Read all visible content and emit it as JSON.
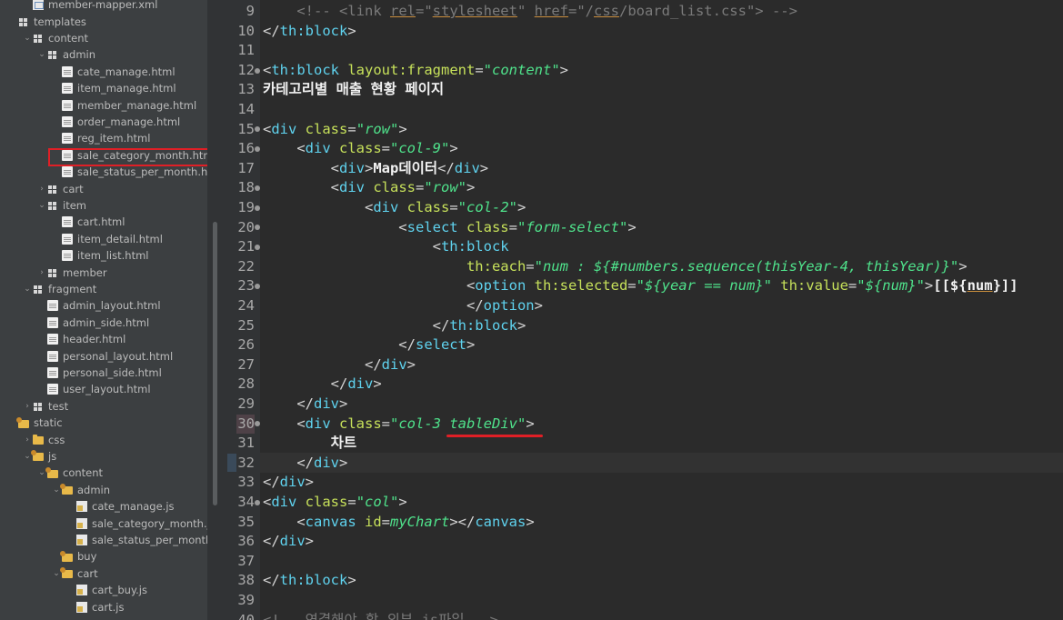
{
  "project_tree": {
    "items": [
      {
        "label": "member-mapper.xml",
        "icon": "xml-file-icon",
        "kind": "xml",
        "indent": 1,
        "arrow": ""
      },
      {
        "label": "templates",
        "icon": "package-icon",
        "kind": "pkg",
        "indent": 0,
        "arrow": ""
      },
      {
        "label": "content",
        "icon": "package-icon",
        "kind": "pkg",
        "indent": 1,
        "arrow": "⌄"
      },
      {
        "label": "admin",
        "icon": "package-icon",
        "kind": "pkg",
        "indent": 2,
        "arrow": "⌄"
      },
      {
        "label": "cate_manage.html",
        "icon": "html-file-icon",
        "kind": "file",
        "indent": 3,
        "arrow": ""
      },
      {
        "label": "item_manage.html",
        "icon": "html-file-icon",
        "kind": "file",
        "indent": 3,
        "arrow": ""
      },
      {
        "label": "member_manage.html",
        "icon": "html-file-icon",
        "kind": "file",
        "indent": 3,
        "arrow": ""
      },
      {
        "label": "order_manage.html",
        "icon": "html-file-icon",
        "kind": "file",
        "indent": 3,
        "arrow": ""
      },
      {
        "label": "reg_item.html",
        "icon": "html-file-icon",
        "kind": "file",
        "indent": 3,
        "arrow": ""
      },
      {
        "label": "sale_category_month.html",
        "icon": "html-file-icon",
        "kind": "file",
        "indent": 3,
        "arrow": ""
      },
      {
        "label": "sale_status_per_month.html",
        "icon": "html-file-icon",
        "kind": "file",
        "indent": 3,
        "arrow": ""
      },
      {
        "label": "cart",
        "icon": "package-icon",
        "kind": "pkg",
        "indent": 2,
        "arrow": "›"
      },
      {
        "label": "item",
        "icon": "package-icon",
        "kind": "pkg",
        "indent": 2,
        "arrow": "⌄"
      },
      {
        "label": "cart.html",
        "icon": "html-file-icon",
        "kind": "file",
        "indent": 3,
        "arrow": ""
      },
      {
        "label": "item_detail.html",
        "icon": "html-file-icon",
        "kind": "file",
        "indent": 3,
        "arrow": ""
      },
      {
        "label": "item_list.html",
        "icon": "html-file-icon",
        "kind": "file",
        "indent": 3,
        "arrow": ""
      },
      {
        "label": "member",
        "icon": "package-icon",
        "kind": "pkg",
        "indent": 2,
        "arrow": "›"
      },
      {
        "label": "fragment",
        "icon": "package-icon",
        "kind": "pkg",
        "indent": 1,
        "arrow": "⌄"
      },
      {
        "label": "admin_layout.html",
        "icon": "html-file-icon",
        "kind": "file",
        "indent": 2,
        "arrow": ""
      },
      {
        "label": "admin_side.html",
        "icon": "html-file-icon",
        "kind": "file",
        "indent": 2,
        "arrow": ""
      },
      {
        "label": "header.html",
        "icon": "html-file-icon",
        "kind": "file",
        "indent": 2,
        "arrow": ""
      },
      {
        "label": "personal_layout.html",
        "icon": "html-file-icon",
        "kind": "file",
        "indent": 2,
        "arrow": ""
      },
      {
        "label": "personal_side.html",
        "icon": "html-file-icon",
        "kind": "file",
        "indent": 2,
        "arrow": ""
      },
      {
        "label": "user_layout.html",
        "icon": "html-file-icon",
        "kind": "file",
        "indent": 2,
        "arrow": ""
      },
      {
        "label": "test",
        "icon": "package-icon",
        "kind": "pkg",
        "indent": 1,
        "arrow": "›"
      },
      {
        "label": "static",
        "icon": "folder-icon",
        "kind": "tfolder",
        "indent": 0,
        "arrow": ""
      },
      {
        "label": "css",
        "icon": "folder-icon",
        "kind": "folder",
        "indent": 1,
        "arrow": "›"
      },
      {
        "label": "js",
        "icon": "folder-icon",
        "kind": "tfolder",
        "indent": 1,
        "arrow": "⌄"
      },
      {
        "label": "content",
        "icon": "folder-icon",
        "kind": "tfolder",
        "indent": 2,
        "arrow": "⌄"
      },
      {
        "label": "admin",
        "icon": "folder-icon",
        "kind": "tfolder",
        "indent": 3,
        "arrow": "⌄"
      },
      {
        "label": "cate_manage.js",
        "icon": "js-file-icon",
        "kind": "js",
        "indent": 4,
        "arrow": ""
      },
      {
        "label": "sale_category_month.js",
        "icon": "js-file-icon",
        "kind": "js",
        "indent": 4,
        "arrow": ""
      },
      {
        "label": "sale_status_per_month.js",
        "icon": "js-file-icon",
        "kind": "js",
        "indent": 4,
        "arrow": ""
      },
      {
        "label": "buy",
        "icon": "folder-icon",
        "kind": "tfolder",
        "indent": 3,
        "arrow": ""
      },
      {
        "label": "cart",
        "icon": "folder-icon",
        "kind": "tfolder",
        "indent": 3,
        "arrow": "⌄"
      },
      {
        "label": "cart_buy.js",
        "icon": "js-file-icon",
        "kind": "js",
        "indent": 4,
        "arrow": ""
      },
      {
        "label": "cart.js",
        "icon": "js-file-icon",
        "kind": "js",
        "indent": 4,
        "arrow": ""
      }
    ]
  },
  "editor": {
    "lines": [
      {
        "no": "9",
        "fold": false,
        "tokens": [
          [
            "c",
            "    <!-- <link "
          ],
          [
            "c u",
            "rel"
          ],
          [
            "c",
            "=\""
          ],
          [
            "c u",
            "stylesheet"
          ],
          [
            "c",
            "\" "
          ],
          [
            "c u",
            "href"
          ],
          [
            "c",
            "=\"/"
          ],
          [
            "c u",
            "css"
          ],
          [
            "c",
            "/board_list.css\"> -->"
          ]
        ]
      },
      {
        "no": "10",
        "fold": false,
        "tokens": [
          [
            "p",
            "</"
          ],
          [
            "t",
            "th:block"
          ],
          [
            "p",
            ">"
          ]
        ]
      },
      {
        "no": "11",
        "fold": false,
        "tokens": []
      },
      {
        "no": "12",
        "fold": true,
        "tokens": [
          [
            "p",
            "<"
          ],
          [
            "t",
            "th:block "
          ],
          [
            "a",
            "layout:fragment"
          ],
          [
            "p",
            "="
          ],
          [
            "s",
            "\"content\""
          ],
          [
            "p",
            ">"
          ]
        ]
      },
      {
        "no": "13",
        "fold": false,
        "tokens": [
          [
            "k",
            "카테고리별 매출 현황 페이지"
          ]
        ]
      },
      {
        "no": "14",
        "fold": false,
        "tokens": []
      },
      {
        "no": "15",
        "fold": true,
        "tokens": [
          [
            "p",
            "<"
          ],
          [
            "t",
            "div "
          ],
          [
            "a",
            "class"
          ],
          [
            "p",
            "="
          ],
          [
            "s",
            "\"row\""
          ],
          [
            "p",
            ">"
          ]
        ]
      },
      {
        "no": "16",
        "fold": true,
        "tokens": [
          [
            "p",
            "    <"
          ],
          [
            "t",
            "div "
          ],
          [
            "a",
            "class"
          ],
          [
            "p",
            "="
          ],
          [
            "s",
            "\"col-9\""
          ],
          [
            "p",
            ">"
          ]
        ]
      },
      {
        "no": "17",
        "fold": false,
        "tokens": [
          [
            "p",
            "        <"
          ],
          [
            "t",
            "div"
          ],
          [
            "p",
            ">"
          ],
          [
            "k",
            "Map데이터"
          ],
          [
            "p",
            "</"
          ],
          [
            "t",
            "div"
          ],
          [
            "p",
            ">"
          ]
        ]
      },
      {
        "no": "18",
        "fold": true,
        "tokens": [
          [
            "p",
            "        <"
          ],
          [
            "t",
            "div "
          ],
          [
            "a",
            "class"
          ],
          [
            "p",
            "="
          ],
          [
            "s",
            "\"row\""
          ],
          [
            "p",
            ">"
          ]
        ]
      },
      {
        "no": "19",
        "fold": true,
        "tokens": [
          [
            "p",
            "            <"
          ],
          [
            "t",
            "div "
          ],
          [
            "a",
            "class"
          ],
          [
            "p",
            "="
          ],
          [
            "s",
            "\"col-2\""
          ],
          [
            "p",
            ">"
          ]
        ]
      },
      {
        "no": "20",
        "fold": true,
        "tokens": [
          [
            "p",
            "                <"
          ],
          [
            "t",
            "select "
          ],
          [
            "a",
            "class"
          ],
          [
            "p",
            "="
          ],
          [
            "s",
            "\"form-select\""
          ],
          [
            "p",
            ">"
          ]
        ]
      },
      {
        "no": "21",
        "fold": true,
        "tokens": [
          [
            "p",
            "                    <"
          ],
          [
            "t",
            "th:block"
          ]
        ]
      },
      {
        "no": "22",
        "fold": false,
        "tokens": [
          [
            "a",
            "                        th:each"
          ],
          [
            "p",
            "="
          ],
          [
            "s",
            "\"num : ${#numbers.sequence(thisYear-4, thisYear)}\""
          ],
          [
            "p",
            ">"
          ]
        ]
      },
      {
        "no": "23",
        "fold": true,
        "tokens": [
          [
            "p",
            "                        <"
          ],
          [
            "t",
            "option "
          ],
          [
            "a",
            "th:selected"
          ],
          [
            "p",
            "="
          ],
          [
            "s",
            "\"${year == num}\" "
          ],
          [
            "a",
            "th:value"
          ],
          [
            "p",
            "="
          ],
          [
            "s",
            "\"${num}\""
          ],
          [
            "p",
            ">"
          ],
          [
            "k",
            "[[${"
          ],
          [
            "k u",
            "num"
          ],
          [
            "k",
            "}]]"
          ]
        ]
      },
      {
        "no": "24",
        "fold": false,
        "tokens": [
          [
            "p",
            "                        </"
          ],
          [
            "t",
            "option"
          ],
          [
            "p",
            ">"
          ]
        ]
      },
      {
        "no": "25",
        "fold": false,
        "tokens": [
          [
            "p",
            "                    </"
          ],
          [
            "t",
            "th:block"
          ],
          [
            "p",
            ">"
          ]
        ]
      },
      {
        "no": "26",
        "fold": false,
        "tokens": [
          [
            "p",
            "                </"
          ],
          [
            "t",
            "select"
          ],
          [
            "p",
            ">"
          ]
        ]
      },
      {
        "no": "27",
        "fold": false,
        "tokens": [
          [
            "p",
            "            </"
          ],
          [
            "t",
            "div"
          ],
          [
            "p",
            ">"
          ]
        ]
      },
      {
        "no": "28",
        "fold": false,
        "tokens": [
          [
            "p",
            "        </"
          ],
          [
            "t",
            "div"
          ],
          [
            "p",
            ">"
          ]
        ]
      },
      {
        "no": "29",
        "fold": false,
        "tokens": [
          [
            "p",
            "    </"
          ],
          [
            "t",
            "div"
          ],
          [
            "p",
            ">"
          ]
        ]
      },
      {
        "no": "30",
        "fold": true,
        "tokens": [
          [
            "p",
            "    <"
          ],
          [
            "t",
            "div "
          ],
          [
            "a",
            "class"
          ],
          [
            "p",
            "="
          ],
          [
            "s",
            "\"col-3 tableDiv\""
          ],
          [
            "p",
            ">"
          ]
        ]
      },
      {
        "no": "31",
        "fold": false,
        "tokens": [
          [
            "k",
            "        차트"
          ]
        ]
      },
      {
        "no": "32",
        "fold": false,
        "tokens": [
          [
            "p",
            "    </"
          ],
          [
            "t",
            "div"
          ],
          [
            "p",
            ">"
          ]
        ]
      },
      {
        "no": "33",
        "fold": false,
        "tokens": [
          [
            "p",
            "</"
          ],
          [
            "t",
            "div"
          ],
          [
            "p",
            ">"
          ]
        ]
      },
      {
        "no": "34",
        "fold": true,
        "tokens": [
          [
            "p",
            "<"
          ],
          [
            "t",
            "div "
          ],
          [
            "a",
            "class"
          ],
          [
            "p",
            "="
          ],
          [
            "s",
            "\"col\""
          ],
          [
            "p",
            ">"
          ]
        ]
      },
      {
        "no": "35",
        "fold": false,
        "tokens": [
          [
            "p",
            "    <"
          ],
          [
            "t",
            "canvas "
          ],
          [
            "a",
            "id"
          ],
          [
            "p",
            "="
          ],
          [
            "s",
            "myChart"
          ],
          [
            "p",
            "></"
          ],
          [
            "t",
            "canvas"
          ],
          [
            "p",
            ">"
          ]
        ]
      },
      {
        "no": "36",
        "fold": false,
        "tokens": [
          [
            "p",
            "</"
          ],
          [
            "t",
            "div"
          ],
          [
            "p",
            ">"
          ]
        ]
      },
      {
        "no": "37",
        "fold": false,
        "tokens": []
      },
      {
        "no": "38",
        "fold": false,
        "tokens": [
          [
            "p",
            "</"
          ],
          [
            "t",
            "th:block"
          ],
          [
            "p",
            ">"
          ]
        ]
      },
      {
        "no": "39",
        "fold": false,
        "tokens": []
      },
      {
        "no": "40",
        "fold": false,
        "tokens": [
          [
            "c",
            "<!-- 연결해야 할 외부 js파일 -->"
          ]
        ]
      }
    ]
  },
  "colors": {
    "tree_bg": "#3c3f41",
    "editor_bg": "#2b2b2b",
    "highlight": "#e01f26"
  }
}
